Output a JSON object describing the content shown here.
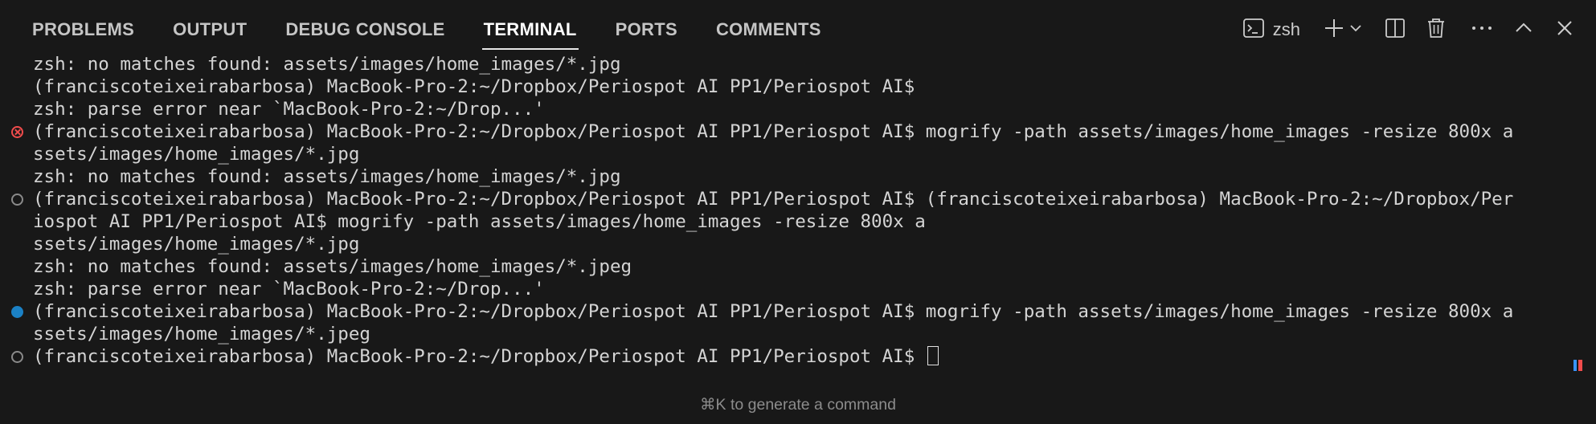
{
  "tabs": [
    {
      "label": "PROBLEMS"
    },
    {
      "label": "OUTPUT"
    },
    {
      "label": "DEBUG CONSOLE"
    },
    {
      "label": "TERMINAL"
    },
    {
      "label": "PORTS"
    },
    {
      "label": "COMMENTS"
    }
  ],
  "active_tab": "TERMINAL",
  "toolbar": {
    "shell_name": "zsh",
    "icons": [
      "terminal-icon",
      "plus-icon",
      "chevron-down-icon",
      "split-icon",
      "trash-icon",
      "more-icon",
      "chevron-up-icon",
      "close-icon"
    ]
  },
  "terminal": {
    "lines": [
      {
        "text": "zsh: no matches found: assets/images/home_images/*.jpg",
        "decoration": ""
      },
      {
        "text": "(franciscoteixeirabarbosa) MacBook-Pro-2:~/Dropbox/Periospot AI PP1/Periospot AI$",
        "decoration": ""
      },
      {
        "text": "zsh: parse error near `MacBook-Pro-2:~/Drop...'",
        "decoration": ""
      },
      {
        "text": "(franciscoteixeirabarbosa) MacBook-Pro-2:~/Dropbox/Periospot AI PP1/Periospot AI$ mogrify -path assets/images/home_images -resize 800x a",
        "decoration": "error"
      },
      {
        "text": "ssets/images/home_images/*.jpg",
        "decoration": ""
      },
      {
        "text": "zsh: no matches found: assets/images/home_images/*.jpg",
        "decoration": ""
      },
      {
        "text": "(franciscoteixeirabarbosa) MacBook-Pro-2:~/Dropbox/Periospot AI PP1/Periospot AI$ (franciscoteixeirabarbosa) MacBook-Pro-2:~/Dropbox/Per",
        "decoration": "default"
      },
      {
        "text": "iospot AI PP1/Periospot AI$ mogrify -path assets/images/home_images -resize 800x a",
        "decoration": ""
      },
      {
        "text": "ssets/images/home_images/*.jpg",
        "decoration": ""
      },
      {
        "text": "zsh: no matches found: assets/images/home_images/*.jpeg",
        "decoration": ""
      },
      {
        "text": "zsh: parse error near `MacBook-Pro-2:~/Drop...'",
        "decoration": ""
      },
      {
        "text": "(franciscoteixeirabarbosa) MacBook-Pro-2:~/Dropbox/Periospot AI PP1/Periospot AI$ mogrify -path assets/images/home_images -resize 800x a",
        "decoration": "success"
      },
      {
        "text": "ssets/images/home_images/*.jpeg",
        "decoration": ""
      },
      {
        "text": "(franciscoteixeirabarbosa) MacBook-Pro-2:~/Dropbox/Periospot AI PP1/Periospot AI$ ",
        "decoration": "default",
        "cursor": true
      }
    ]
  },
  "hint": "⌘K to generate a command",
  "colors": {
    "background": "#181818",
    "error": "#f14c4c",
    "success": "#1b81c5",
    "default_marker": "#8a8a8a"
  }
}
